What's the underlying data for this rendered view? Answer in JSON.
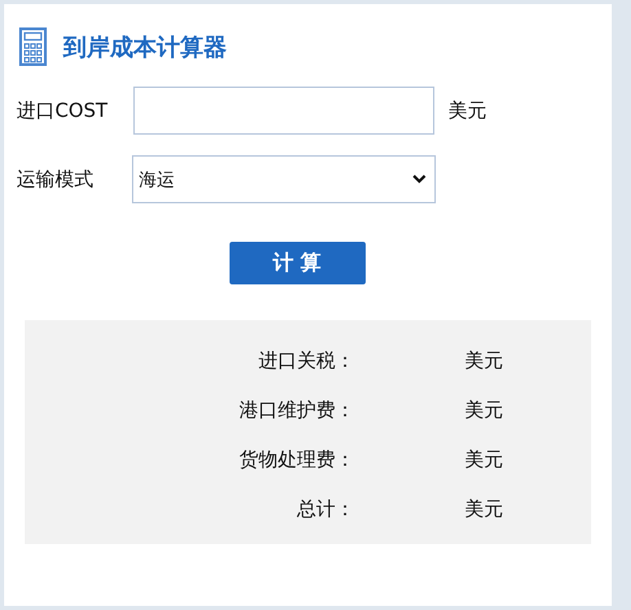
{
  "title": "到岸成本计算器",
  "form": {
    "cost_label": "进口COST",
    "cost_unit": "美元",
    "mode_label": "运输模式",
    "mode_value": "海运"
  },
  "calculate_button": "计 算",
  "results": [
    {
      "label": "进口关税：",
      "unit": "美元"
    },
    {
      "label": "港口维护费：",
      "unit": "美元"
    },
    {
      "label": "货物处理费：",
      "unit": "美元"
    },
    {
      "label": "总计：",
      "unit": "美元"
    }
  ]
}
